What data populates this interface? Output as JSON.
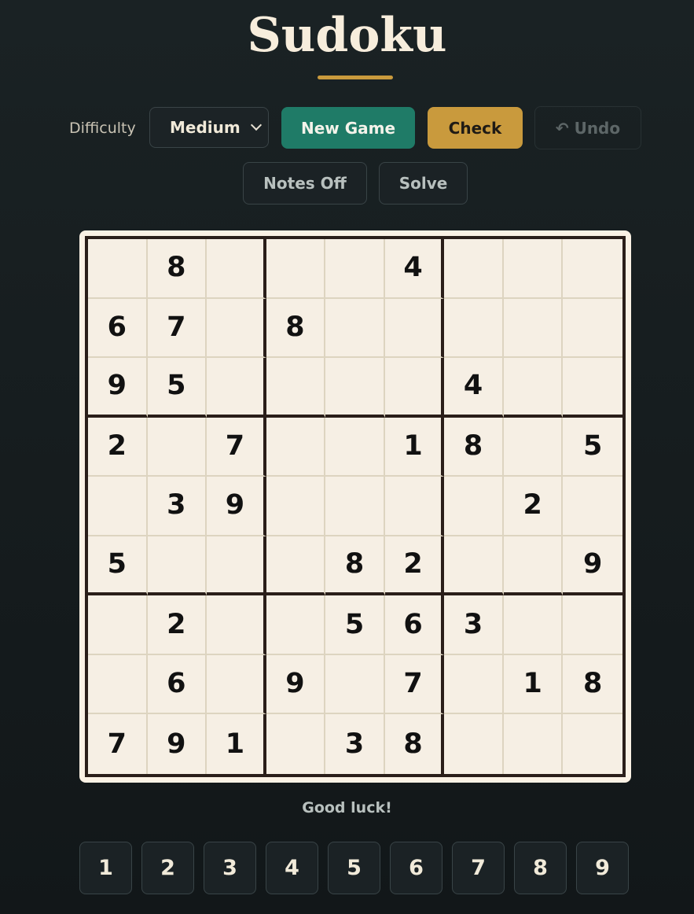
{
  "title": "Sudoku",
  "controls": {
    "difficulty_label": "Difficulty",
    "difficulty_value": "Medium",
    "new_game": "New Game",
    "check": "Check",
    "undo": "↶ Undo",
    "notes": "Notes Off",
    "solve": "Solve"
  },
  "board": [
    [
      "",
      "8",
      "",
      "",
      "",
      "4",
      "",
      "",
      ""
    ],
    [
      "6",
      "7",
      "",
      "8",
      "",
      "",
      "",
      "",
      ""
    ],
    [
      "9",
      "5",
      "",
      "",
      "",
      "",
      "4",
      "",
      ""
    ],
    [
      "2",
      "",
      "7",
      "",
      "",
      "1",
      "8",
      "",
      "5"
    ],
    [
      "",
      "3",
      "9",
      "",
      "",
      "",
      "",
      "2",
      ""
    ],
    [
      "5",
      "",
      "",
      "",
      "8",
      "2",
      "",
      "",
      "9"
    ],
    [
      "",
      "2",
      "",
      "",
      "5",
      "6",
      "3",
      "",
      ""
    ],
    [
      "",
      "6",
      "",
      "9",
      "",
      "7",
      "",
      "1",
      "8"
    ],
    [
      "7",
      "9",
      "1",
      "",
      "3",
      "8",
      "",
      "",
      ""
    ]
  ],
  "status": "Good luck!",
  "number_pad": [
    "1",
    "2",
    "3",
    "4",
    "5",
    "6",
    "7",
    "8",
    "9"
  ],
  "colors": {
    "background": "#121719",
    "board": "#f6efe4",
    "new_game": "#1f7b67",
    "check": "#c99a3d",
    "grid_line": "#2a1e19"
  }
}
